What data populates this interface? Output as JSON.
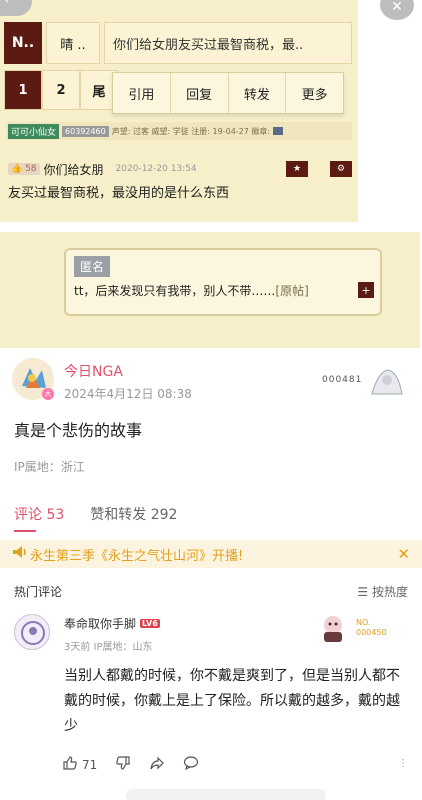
{
  "forum": {
    "nav_n": "N..",
    "nav_q": "晴 ..",
    "thread_title": "你们给女朋友买过最智商税，最..",
    "pages": [
      "1",
      "2",
      "尾"
    ],
    "popup_menu": [
      "引用",
      "回复",
      "转发",
      "更多"
    ],
    "user_bar": {
      "name": "可可小仙女",
      "id": "60392460",
      "info": "声望: 过客 威望: 学徒 注册: 19-04-27 徽章:"
    },
    "post": {
      "likes": "58",
      "title": "你们给女朋",
      "time": "2020-12-20 13:54",
      "body": "友买过最智商税，最没用的是什么东西"
    },
    "quote": {
      "anon_label": "匿名",
      "text": "tt，后来发现只有我带，别人不带……",
      "original_link": "[原帖]"
    }
  },
  "post": {
    "author": "今日NGA",
    "time": "2024年4月12日 08:38",
    "deco_number": "000481",
    "content": "真是个悲伤的故事",
    "ip_location": "IP属地：浙江"
  },
  "tabs": [
    {
      "label": "评论 53"
    },
    {
      "label": "赞和转发 292"
    }
  ],
  "banner": {
    "text": "永生第三季《永生之气壮山河》开播!"
  },
  "comments_header": {
    "title": "热门评论",
    "sort_label": "按热度"
  },
  "comment": {
    "name": "奉命取你手脚",
    "level": "LV6",
    "meta": "3天前  IP属地：山东",
    "deco_number": "NO.\n000450",
    "text": "当别人都戴的时候，你不戴是爽到了，但是当别人都不戴的时候，你戴上是上了保险。所以戴的越多，戴的越少",
    "likes": "71"
  },
  "colors": {
    "accent": "#e0506a",
    "forum_bg": "#f6efc9",
    "forum_dark": "#5b1a12",
    "banner_text": "#e2a020"
  }
}
